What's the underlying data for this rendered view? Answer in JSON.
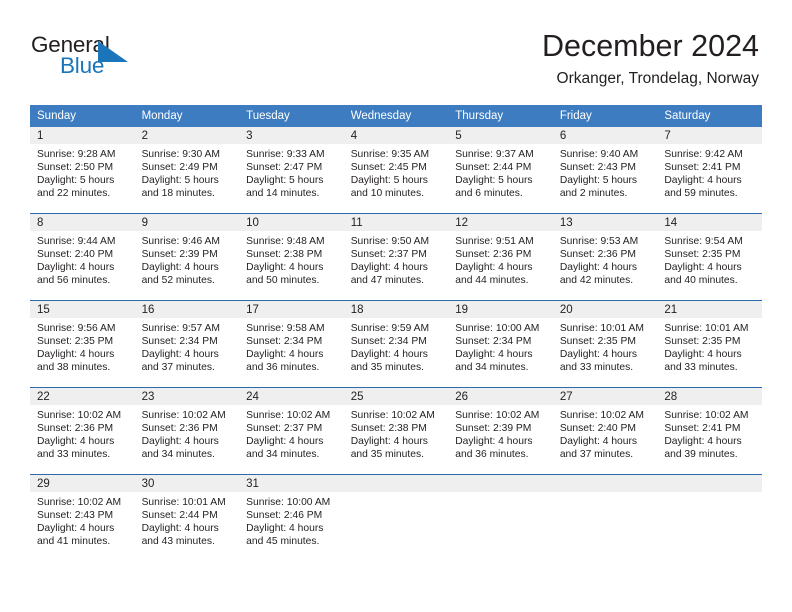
{
  "brand": {
    "word_one": "General",
    "word_two": "Blue",
    "flag_icon": "triangle-flag-icon"
  },
  "header": {
    "title": "December 2024",
    "location": "Orkanger, Trondelag, Norway"
  },
  "colors": {
    "header_blue": "#3d7cc0",
    "row_divider_blue": "#2d6aab",
    "date_strip_gray": "#efefef",
    "brand_blue": "#1b75bb",
    "text": "#231f20"
  },
  "day_names": [
    "Sunday",
    "Monday",
    "Tuesday",
    "Wednesday",
    "Thursday",
    "Friday",
    "Saturday"
  ],
  "weeks": [
    [
      {
        "day": "1",
        "sunrise": "Sunrise: 9:28 AM",
        "sunset": "Sunset: 2:50 PM",
        "daylight_1": "Daylight: 5 hours",
        "daylight_2": "and 22 minutes."
      },
      {
        "day": "2",
        "sunrise": "Sunrise: 9:30 AM",
        "sunset": "Sunset: 2:49 PM",
        "daylight_1": "Daylight: 5 hours",
        "daylight_2": "and 18 minutes."
      },
      {
        "day": "3",
        "sunrise": "Sunrise: 9:33 AM",
        "sunset": "Sunset: 2:47 PM",
        "daylight_1": "Daylight: 5 hours",
        "daylight_2": "and 14 minutes."
      },
      {
        "day": "4",
        "sunrise": "Sunrise: 9:35 AM",
        "sunset": "Sunset: 2:45 PM",
        "daylight_1": "Daylight: 5 hours",
        "daylight_2": "and 10 minutes."
      },
      {
        "day": "5",
        "sunrise": "Sunrise: 9:37 AM",
        "sunset": "Sunset: 2:44 PM",
        "daylight_1": "Daylight: 5 hours",
        "daylight_2": "and 6 minutes."
      },
      {
        "day": "6",
        "sunrise": "Sunrise: 9:40 AM",
        "sunset": "Sunset: 2:43 PM",
        "daylight_1": "Daylight: 5 hours",
        "daylight_2": "and 2 minutes."
      },
      {
        "day": "7",
        "sunrise": "Sunrise: 9:42 AM",
        "sunset": "Sunset: 2:41 PM",
        "daylight_1": "Daylight: 4 hours",
        "daylight_2": "and 59 minutes."
      }
    ],
    [
      {
        "day": "8",
        "sunrise": "Sunrise: 9:44 AM",
        "sunset": "Sunset: 2:40 PM",
        "daylight_1": "Daylight: 4 hours",
        "daylight_2": "and 56 minutes."
      },
      {
        "day": "9",
        "sunrise": "Sunrise: 9:46 AM",
        "sunset": "Sunset: 2:39 PM",
        "daylight_1": "Daylight: 4 hours",
        "daylight_2": "and 52 minutes."
      },
      {
        "day": "10",
        "sunrise": "Sunrise: 9:48 AM",
        "sunset": "Sunset: 2:38 PM",
        "daylight_1": "Daylight: 4 hours",
        "daylight_2": "and 50 minutes."
      },
      {
        "day": "11",
        "sunrise": "Sunrise: 9:50 AM",
        "sunset": "Sunset: 2:37 PM",
        "daylight_1": "Daylight: 4 hours",
        "daylight_2": "and 47 minutes."
      },
      {
        "day": "12",
        "sunrise": "Sunrise: 9:51 AM",
        "sunset": "Sunset: 2:36 PM",
        "daylight_1": "Daylight: 4 hours",
        "daylight_2": "and 44 minutes."
      },
      {
        "day": "13",
        "sunrise": "Sunrise: 9:53 AM",
        "sunset": "Sunset: 2:36 PM",
        "daylight_1": "Daylight: 4 hours",
        "daylight_2": "and 42 minutes."
      },
      {
        "day": "14",
        "sunrise": "Sunrise: 9:54 AM",
        "sunset": "Sunset: 2:35 PM",
        "daylight_1": "Daylight: 4 hours",
        "daylight_2": "and 40 minutes."
      }
    ],
    [
      {
        "day": "15",
        "sunrise": "Sunrise: 9:56 AM",
        "sunset": "Sunset: 2:35 PM",
        "daylight_1": "Daylight: 4 hours",
        "daylight_2": "and 38 minutes."
      },
      {
        "day": "16",
        "sunrise": "Sunrise: 9:57 AM",
        "sunset": "Sunset: 2:34 PM",
        "daylight_1": "Daylight: 4 hours",
        "daylight_2": "and 37 minutes."
      },
      {
        "day": "17",
        "sunrise": "Sunrise: 9:58 AM",
        "sunset": "Sunset: 2:34 PM",
        "daylight_1": "Daylight: 4 hours",
        "daylight_2": "and 36 minutes."
      },
      {
        "day": "18",
        "sunrise": "Sunrise: 9:59 AM",
        "sunset": "Sunset: 2:34 PM",
        "daylight_1": "Daylight: 4 hours",
        "daylight_2": "and 35 minutes."
      },
      {
        "day": "19",
        "sunrise": "Sunrise: 10:00 AM",
        "sunset": "Sunset: 2:34 PM",
        "daylight_1": "Daylight: 4 hours",
        "daylight_2": "and 34 minutes."
      },
      {
        "day": "20",
        "sunrise": "Sunrise: 10:01 AM",
        "sunset": "Sunset: 2:35 PM",
        "daylight_1": "Daylight: 4 hours",
        "daylight_2": "and 33 minutes."
      },
      {
        "day": "21",
        "sunrise": "Sunrise: 10:01 AM",
        "sunset": "Sunset: 2:35 PM",
        "daylight_1": "Daylight: 4 hours",
        "daylight_2": "and 33 minutes."
      }
    ],
    [
      {
        "day": "22",
        "sunrise": "Sunrise: 10:02 AM",
        "sunset": "Sunset: 2:36 PM",
        "daylight_1": "Daylight: 4 hours",
        "daylight_2": "and 33 minutes."
      },
      {
        "day": "23",
        "sunrise": "Sunrise: 10:02 AM",
        "sunset": "Sunset: 2:36 PM",
        "daylight_1": "Daylight: 4 hours",
        "daylight_2": "and 34 minutes."
      },
      {
        "day": "24",
        "sunrise": "Sunrise: 10:02 AM",
        "sunset": "Sunset: 2:37 PM",
        "daylight_1": "Daylight: 4 hours",
        "daylight_2": "and 34 minutes."
      },
      {
        "day": "25",
        "sunrise": "Sunrise: 10:02 AM",
        "sunset": "Sunset: 2:38 PM",
        "daylight_1": "Daylight: 4 hours",
        "daylight_2": "and 35 minutes."
      },
      {
        "day": "26",
        "sunrise": "Sunrise: 10:02 AM",
        "sunset": "Sunset: 2:39 PM",
        "daylight_1": "Daylight: 4 hours",
        "daylight_2": "and 36 minutes."
      },
      {
        "day": "27",
        "sunrise": "Sunrise: 10:02 AM",
        "sunset": "Sunset: 2:40 PM",
        "daylight_1": "Daylight: 4 hours",
        "daylight_2": "and 37 minutes."
      },
      {
        "day": "28",
        "sunrise": "Sunrise: 10:02 AM",
        "sunset": "Sunset: 2:41 PM",
        "daylight_1": "Daylight: 4 hours",
        "daylight_2": "and 39 minutes."
      }
    ],
    [
      {
        "day": "29",
        "sunrise": "Sunrise: 10:02 AM",
        "sunset": "Sunset: 2:43 PM",
        "daylight_1": "Daylight: 4 hours",
        "daylight_2": "and 41 minutes."
      },
      {
        "day": "30",
        "sunrise": "Sunrise: 10:01 AM",
        "sunset": "Sunset: 2:44 PM",
        "daylight_1": "Daylight: 4 hours",
        "daylight_2": "and 43 minutes."
      },
      {
        "day": "31",
        "sunrise": "Sunrise: 10:00 AM",
        "sunset": "Sunset: 2:46 PM",
        "daylight_1": "Daylight: 4 hours",
        "daylight_2": "and 45 minutes."
      },
      {
        "day": "",
        "sunrise": "",
        "sunset": "",
        "daylight_1": "",
        "daylight_2": ""
      },
      {
        "day": "",
        "sunrise": "",
        "sunset": "",
        "daylight_1": "",
        "daylight_2": ""
      },
      {
        "day": "",
        "sunrise": "",
        "sunset": "",
        "daylight_1": "",
        "daylight_2": ""
      },
      {
        "day": "",
        "sunrise": "",
        "sunset": "",
        "daylight_1": "",
        "daylight_2": ""
      }
    ]
  ]
}
